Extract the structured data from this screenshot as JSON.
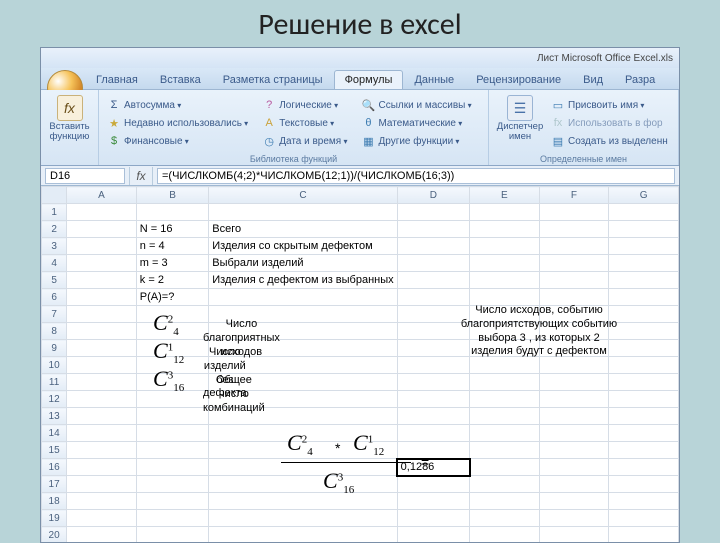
{
  "slide_title": "Решение в excel",
  "window_title": "Лист Microsoft Office Excel.xls",
  "tabs": [
    "Главная",
    "Вставка",
    "Разметка страницы",
    "Формулы",
    "Данные",
    "Рецензирование",
    "Вид",
    "Разра"
  ],
  "active_tab_index": 3,
  "ribbon": {
    "insert_function": {
      "label": "Вставить\nфункцию",
      "icon": "fx"
    },
    "group1": {
      "autosum": "Автосумма",
      "recent": "Недавно использовались",
      "financial": "Финансовые",
      "label": "Библиотека функций"
    },
    "group2": {
      "logical": "Логические",
      "text": "Текстовые",
      "date": "Дата и время"
    },
    "group3": {
      "lookup": "Ссылки и массивы",
      "math": "Математические",
      "other": "Другие функции"
    },
    "names": {
      "big": "Диспетчер\nимен",
      "define": "Присвоить имя",
      "use": "Использовать в фор",
      "create": "Создать из выделенн",
      "label": "Определенные имен"
    }
  },
  "namebox": "D16",
  "formula": "=(ЧИСЛКОМБ(4;2)*ЧИСЛКОМБ(12;1))/(ЧИСЛКОМБ(16;3))",
  "columns": [
    "A",
    "B",
    "C",
    "D",
    "E",
    "F",
    "G"
  ],
  "row_count": 20,
  "cells": {
    "B2": "N = 16",
    "C2": "Всего",
    "B3": "n = 4",
    "C3": "Изделия со скрытым дефектом",
    "B4": "m = 3",
    "C4": "Выбрали изделий",
    "B5": "k = 2",
    "C5": "Изделия с дефектом из выбранных",
    "B6": "P(A)=?",
    "D16": "0,1286"
  },
  "overlay": {
    "c1": {
      "top": "2",
      "bottom": "4"
    },
    "c2": {
      "top": "1",
      "bottom": "12"
    },
    "c3": {
      "top": "3",
      "bottom": "16"
    },
    "note1": "Число благоприятных исходов",
    "note2": "Число изделий без дефекта",
    "note3": "Общее число комбинаций",
    "side": "Число исходов, событию благоприятствующих событию выбора 3 , из которых 2 изделия будут с дефектом",
    "times": "*",
    "eq": "="
  }
}
